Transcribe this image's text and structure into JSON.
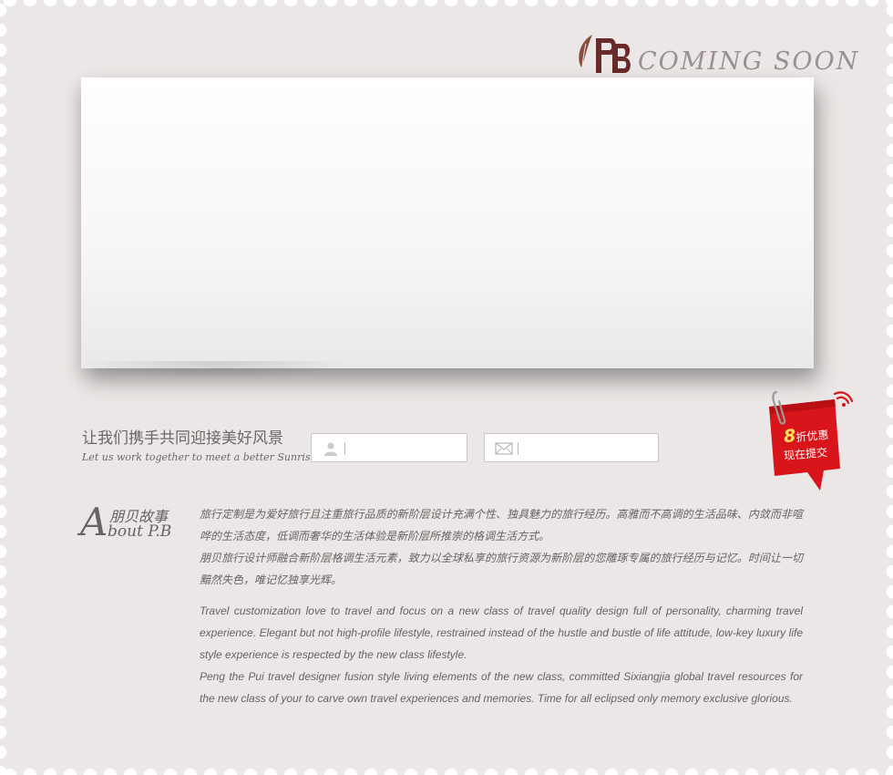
{
  "brand": {
    "logo_mark": "PB",
    "coming_soon": "COMING SOON"
  },
  "slogan": {
    "cn": "让我们携手共同迎接美好风景",
    "en": "Let us work together to meet a better Sunrise"
  },
  "form": {
    "name_icon": "user-icon",
    "name_value": "",
    "email_icon": "envelope-icon",
    "email_value": ""
  },
  "promo": {
    "discount_number": "8",
    "discount_text": "折优惠",
    "action_text": "现在提交",
    "icon": "paperclip-icon",
    "colors": {
      "tag": "#d9151c",
      "highlight": "#ffe35a"
    }
  },
  "about": {
    "initial": "A",
    "title_cn": "朋贝故事",
    "title_en": "bout P.B",
    "paragraphs_cn": [
      "旅行定制是为爱好旅行且注重旅行品质的新阶层设计充满个性、独具魅力的旅行经历。高雅而不高调的生活品味、内敛而非喧哗的生活态度，低调而奢华的生活体验是新阶层所推崇的格调生活方式。",
      "朋贝旅行设计师融合新阶层格调生活元素，致力以全球私享的旅行资源为新阶层的您雕琢专属的旅行经历与记忆。时间让一切黯然失色，唯记忆独享光辉。"
    ],
    "paragraphs_en": [
      "Travel customization love to travel and focus on a new class of travel quality design full of personality, charming travel experience. Elegant but not high-profile lifestyle, restrained instead of the hustle and bustle of life attitude, low-key luxury life style experience is respected by the new class lifestyle.",
      "Peng the Pui travel designer fusion style living elements of the new class, committed Sixiangjia global travel resources for the new class of your to carve own travel experiences and memories. Time for all eclipsed only memory exclusive glorious."
    ]
  },
  "colors": {
    "stamp_bg": "#ebe7e6",
    "brand_brown": "#6b2a2a",
    "text_gray": "#6a6162"
  }
}
